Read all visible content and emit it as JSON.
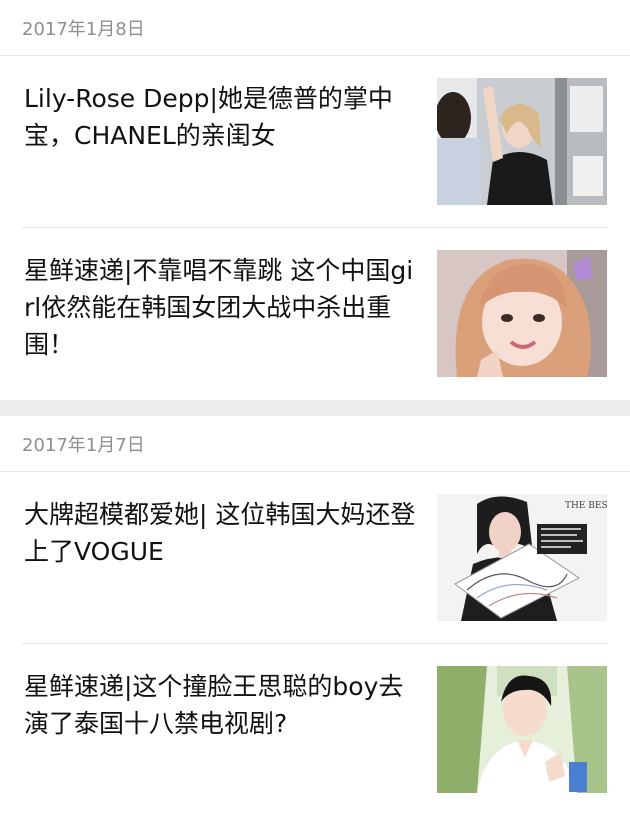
{
  "sections": [
    {
      "date": "2017年1月8日",
      "articles": [
        {
          "title": "Lily-Rose Depp|她是德普的掌中宝，CHANEL的亲闺女",
          "thumbnail": "photo-thumbnail"
        },
        {
          "title": "星鲜速递|不靠唱不靠跳 这个中国girl依然能在韩国女团大战中杀出重围！",
          "thumbnail": "photo-thumbnail"
        }
      ]
    },
    {
      "date": "2017年1月7日",
      "articles": [
        {
          "title": "大牌超模都爱她| 这位韩国大妈还登上了VOGUE",
          "thumbnail": "photo-thumbnail",
          "thumb_text": "THE BEST"
        },
        {
          "title": "星鲜速递|这个撞脸王思聪的boy去演了泰国十八禁电视剧?",
          "thumbnail": "photo-thumbnail"
        }
      ]
    }
  ]
}
